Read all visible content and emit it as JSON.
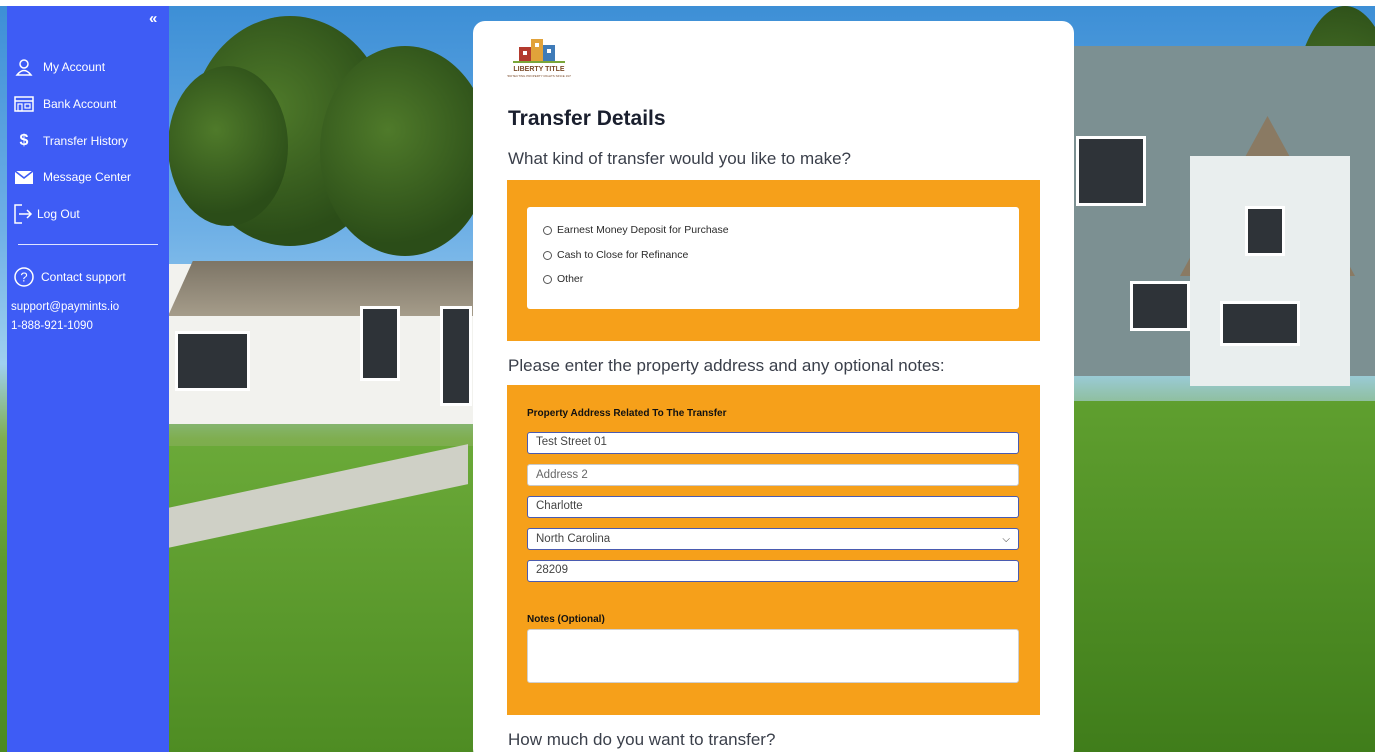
{
  "sidebar": {
    "collapse_icon": "double-chevron-left-icon",
    "items": [
      {
        "label": "My Account",
        "icon": "user-icon"
      },
      {
        "label": "Bank Account",
        "icon": "bank-icon"
      },
      {
        "label": "Transfer History",
        "icon": "dollar-icon"
      },
      {
        "label": "Message Center",
        "icon": "envelope-icon"
      },
      {
        "label": "Log Out",
        "icon": "logout-icon"
      }
    ],
    "support": {
      "title": "Contact support",
      "email": "support@paymints.io",
      "phone": "1-888-921-1090"
    }
  },
  "logo": {
    "text": "LIBERTY TITLE",
    "tagline": "PROTECTING PROPERTY RIGHTS SINCE 1976"
  },
  "form": {
    "title": "Transfer Details",
    "q1": "What kind of transfer would you like to make?",
    "transfer_options": [
      "Earnest Money Deposit for Purchase",
      "Cash to Close for Refinance",
      "Other"
    ],
    "q2": "Please enter the property address and any optional notes:",
    "address_label": "Property Address Related To The Transfer",
    "address1": "Test Street 01",
    "address2_placeholder": "Address 2",
    "city": "Charlotte",
    "state": "North Carolina",
    "zip": "28209",
    "notes_label": "Notes (Optional)",
    "q3": "How much do you want to transfer?"
  },
  "colors": {
    "sidebar": "#3e5cf5",
    "accent": "#f6a01a"
  }
}
